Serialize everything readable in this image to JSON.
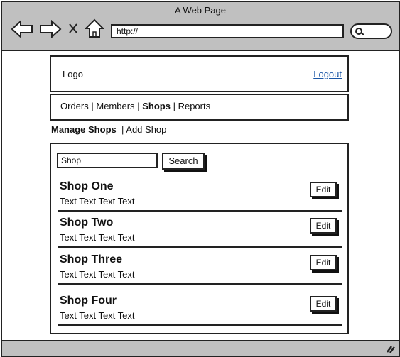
{
  "browser": {
    "title": "A Web Page",
    "url": "http://",
    "icons": [
      "back-arrow-icon",
      "forward-arrow-icon",
      "stop-x-icon",
      "home-icon",
      "search-icon",
      "resize-grip-icon"
    ]
  },
  "header": {
    "logo": "Logo",
    "logout": "Logout"
  },
  "nav": {
    "items": [
      "Orders",
      "Members",
      "Shops",
      "Reports"
    ],
    "separator": "|",
    "active": "Shops"
  },
  "subnav": {
    "manage": "Manage Shops",
    "separator": "|",
    "add": "Add Shop"
  },
  "search": {
    "value": "Shop",
    "button": "Search"
  },
  "shops": [
    {
      "name": "Shop One",
      "desc": "Text Text Text Text",
      "edit": "Edit"
    },
    {
      "name": "Shop Two",
      "desc": "Text Text Text Text",
      "edit": "Edit"
    },
    {
      "name": "Shop Three",
      "desc": "Text Text Text Text",
      "edit": "Edit"
    },
    {
      "name": "Shop Four",
      "desc": "Text Text Text Text",
      "edit": "Edit"
    }
  ]
}
